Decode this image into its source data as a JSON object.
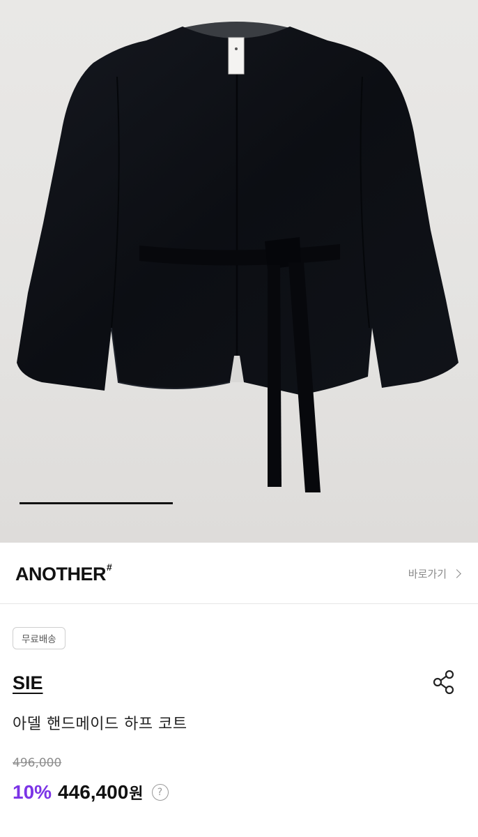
{
  "gallery": {
    "image_alt": "black collarless belted half coat product photo",
    "tag_text": "SIE"
  },
  "brand": {
    "name": "ANOTHER",
    "mark": "#",
    "link_label": "바로가기"
  },
  "product": {
    "badge": "무료배송",
    "seller": "SIE",
    "title": "아델 핸드메이드 하프 코트",
    "original_price": "496,000",
    "discount": "10%",
    "sale_price": "446,400",
    "currency": "원",
    "help_glyph": "?"
  },
  "colors": {
    "accent": "#7b34e6",
    "background_photo": "#e6e5e3",
    "coat": "#0d0f14"
  }
}
